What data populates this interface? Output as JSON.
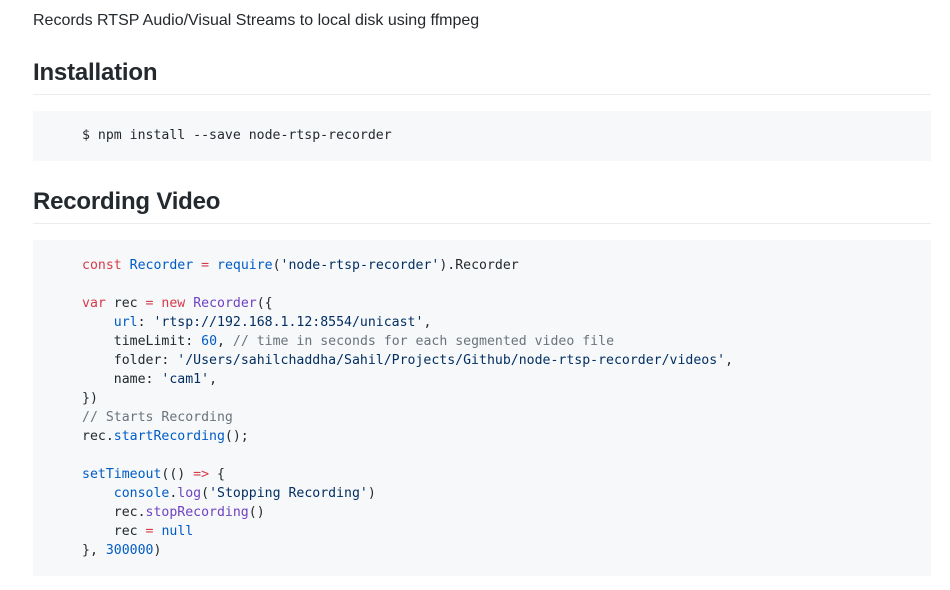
{
  "readme": {
    "intro": "Records RTSP Audio/Visual Streams to local disk using ffmpeg",
    "sections": {
      "installation": {
        "heading": "Installation",
        "command": "$ npm install --save node-rtsp-recorder"
      },
      "recording": {
        "heading": "Recording Video"
      }
    },
    "code": {
      "l1": {
        "kw": "const",
        "cls": "Recorder",
        "op": " = ",
        "fn": "require",
        "str": "'node-rtsp-recorder'",
        "rest": ").Recorder"
      },
      "l3": {
        "kw": "var",
        "id": " rec ",
        "op": "= ",
        "kw2": "new",
        "ent": " Recorder",
        "rest": "({"
      },
      "l4": {
        "indent": "    ",
        "key": "url",
        "colon": ": ",
        "str": "'rtsp://192.168.1.12:8554/unicast'",
        "rest": ","
      },
      "l5": {
        "indent": "    ",
        "key": "timeLimit",
        "colon": ": ",
        "num": "60",
        "rest": ", ",
        "com": "// time in seconds for each segmented video file"
      },
      "l6": {
        "indent": "    ",
        "key": "folder",
        "colon": ": ",
        "str": "'/Users/sahilchaddha/Sahil/Projects/Github/node-rtsp-recorder/videos'",
        "rest": ","
      },
      "l7": {
        "indent": "    ",
        "key": "name",
        "colon": ": ",
        "str": "'cam1'",
        "rest": ","
      },
      "l8": {
        "text": "})"
      },
      "l9": {
        "com": "// Starts Recording"
      },
      "l10": {
        "id": "rec.",
        "fn": "startRecording",
        "rest": "();"
      },
      "l12": {
        "fn": "setTimeout",
        "rest": "(() ",
        "op": "=>",
        "rest2": " {"
      },
      "l13": {
        "indent": "    ",
        "obj": "console",
        "dot": ".",
        "fn": "log",
        "open": "(",
        "str": "'Stopping Recording'",
        "close": ")"
      },
      "l14": {
        "indent": "    ",
        "id": "rec.",
        "fn": "stopRecording",
        "rest": "()"
      },
      "l15": {
        "indent": "    ",
        "id": "rec ",
        "op": "=",
        "sp": " ",
        "num": "null"
      },
      "l16": {
        "text": "}, ",
        "num": "300000",
        "rest": ")"
      }
    }
  }
}
